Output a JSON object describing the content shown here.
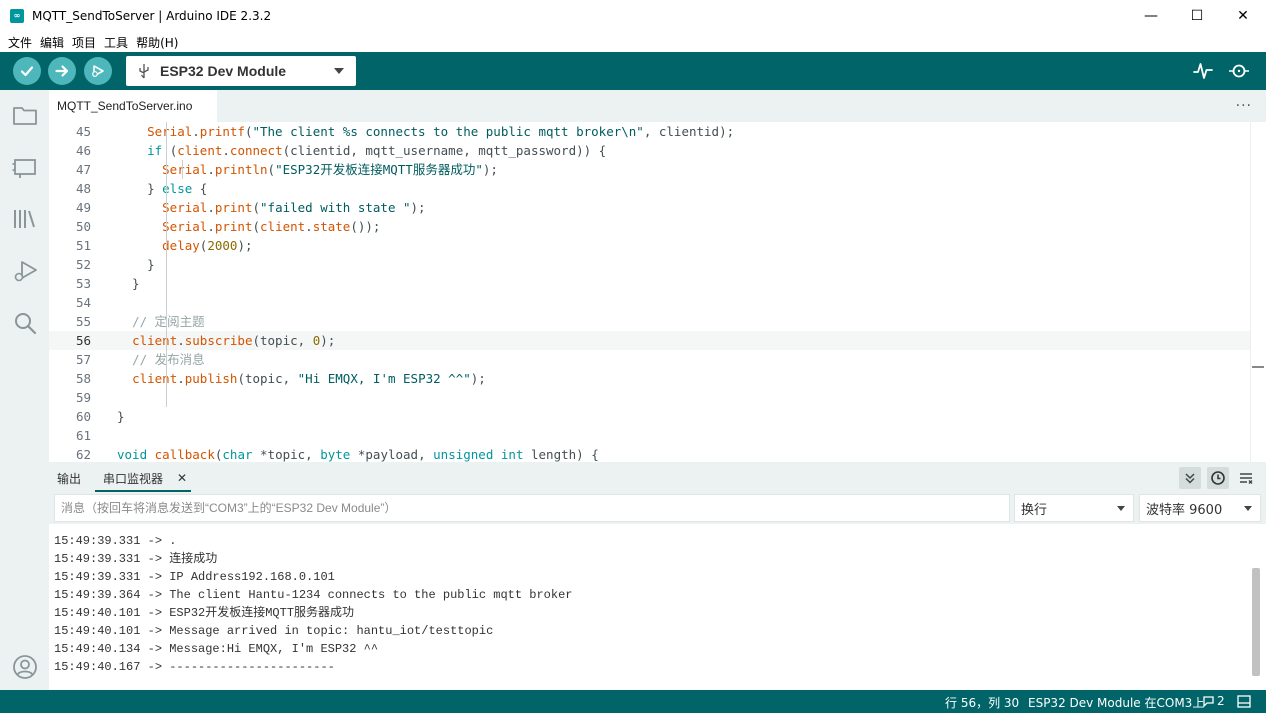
{
  "window": {
    "title": "MQTT_SendToServer | Arduino IDE 2.3.2",
    "app_icon_glyph": "∞",
    "controls": [
      "—",
      "☐",
      "✕"
    ]
  },
  "menu": [
    "文件",
    "编辑",
    "项目",
    "工具",
    "帮助(H)"
  ],
  "toolbar": {
    "board": "ESP32 Dev Module",
    "accent": "#006468",
    "button_color": "#4db7bb"
  },
  "tab": {
    "file": "MQTT_SendToServer.ino",
    "more": "···"
  },
  "editor": {
    "current_line": 56,
    "lines": [
      {
        "n": 45,
        "html": "    <span class='kw-fn'>Serial</span>.<span class='kw-fn'>printf</span>(<span class='str'>\"The client %s connects to the public mqtt broker\\n\"</span>, clientid);"
      },
      {
        "n": 46,
        "html": "    <span class='kw-type'>if</span> (<span class='kw-fn'>client</span>.<span class='kw-fn'>connect</span>(clientid, mqtt_username, mqtt_password)) {"
      },
      {
        "n": 47,
        "html": "      <span class='kw-fn'>Serial</span>.<span class='kw-fn'>println</span>(<span class='str'>\"ESP32开发板连接MQTT服务器成功\"</span>);"
      },
      {
        "n": 48,
        "html": "    } <span class='kw-type'>else</span> {"
      },
      {
        "n": 49,
        "html": "      <span class='kw-fn'>Serial</span>.<span class='kw-fn'>print</span>(<span class='str'>\"failed with state \"</span>);"
      },
      {
        "n": 50,
        "html": "      <span class='kw-fn'>Serial</span>.<span class='kw-fn'>print</span>(<span class='kw-fn'>client</span>.<span class='kw-fn'>state</span>());"
      },
      {
        "n": 51,
        "html": "      <span class='kw-fn'>delay</span>(<span class='num'>2000</span>);"
      },
      {
        "n": 52,
        "html": "    }"
      },
      {
        "n": 53,
        "html": "  }"
      },
      {
        "n": 54,
        "html": ""
      },
      {
        "n": 55,
        "html": "  <span class='cmt'>// 定阅主题</span>"
      },
      {
        "n": 56,
        "html": "  <span class='kw-fn'>client</span>.<span class='kw-fn'>subscribe</span>(topic, <span class='num'>0</span>);"
      },
      {
        "n": 57,
        "html": "  <span class='cmt'>// 发布消息</span>"
      },
      {
        "n": 58,
        "html": "  <span class='kw-fn'>client</span>.<span class='kw-fn'>publish</span>(topic, <span class='str'>\"Hi EMQX, I'm ESP32 ^^\"</span>);"
      },
      {
        "n": 59,
        "html": ""
      },
      {
        "n": 60,
        "html": "}"
      },
      {
        "n": 61,
        "html": ""
      },
      {
        "n": 62,
        "html": "<span class='kw-type'>void</span> <span class='kw-fn'>callback</span>(<span class='kw-type'>char</span> *topic, <span class='kw-type'>byte</span> *payload, <span class='kw-type'>unsigned</span> <span class='kw-type'>int</span> length) {"
      }
    ]
  },
  "panel": {
    "tab_output": "输出",
    "tab_serial": "串口监视器",
    "close": "✕",
    "message_placeholder": "消息（按回车将消息发送到“COM3”上的“ESP32 Dev Module”）",
    "line_ending": "换行",
    "baud": "波特率 9600",
    "serial_lines": [
      "15:49:39.331 -> .",
      "15:49:39.331 -> 连接成功",
      "15:49:39.331 -> IP Address192.168.0.101",
      "15:49:39.364 -> The client Hantu-1234 connects to the public mqtt broker",
      "15:49:40.101 -> ESP32开发板连接MQTT服务器成功",
      "15:49:40.101 -> Message arrived in topic: hantu_iot/testtopic",
      "15:49:40.134 -> Message:Hi EMQX, I'm ESP32 ^^",
      "15:49:40.167 -> -----------------------"
    ]
  },
  "status": {
    "position": "行 56，列 30",
    "board_port": "ESP32 Dev Module 在COM3上",
    "notifications": "2"
  }
}
